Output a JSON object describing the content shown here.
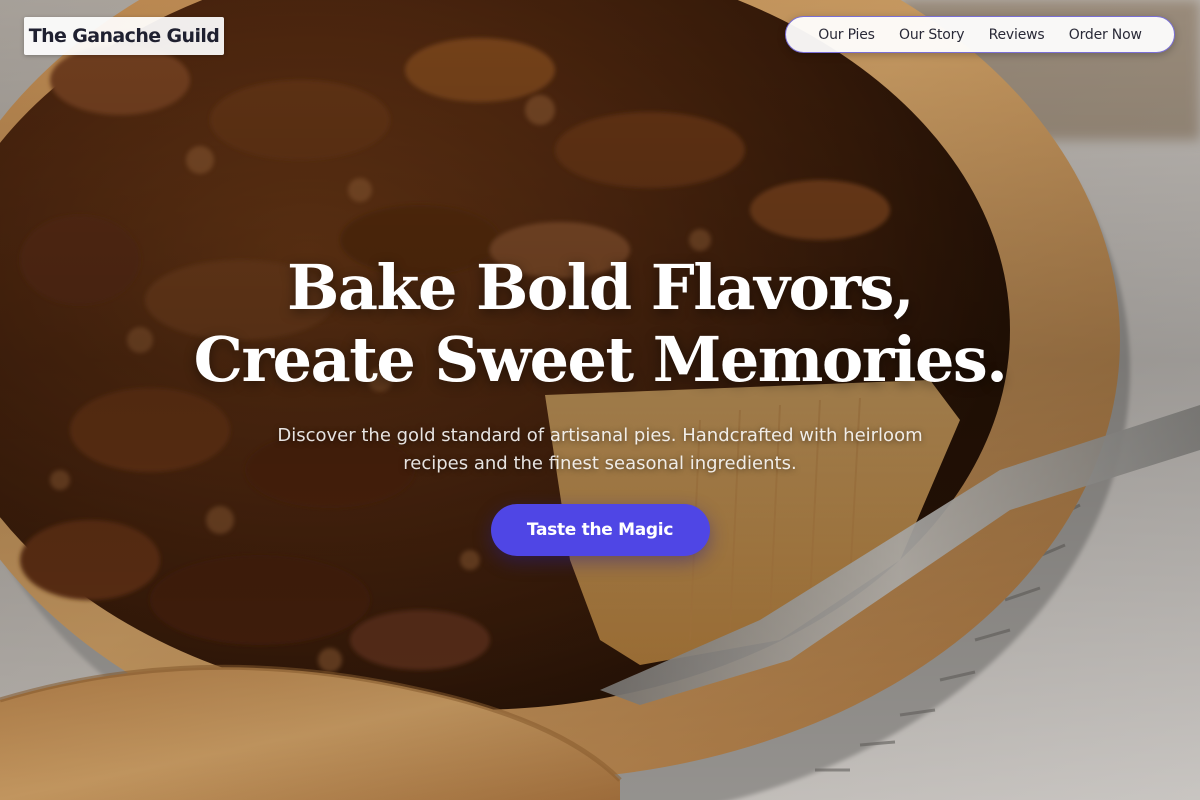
{
  "brand": {
    "name": "The Ganache Guild"
  },
  "nav": {
    "items": [
      {
        "label": "Our Pies"
      },
      {
        "label": "Our Story"
      },
      {
        "label": "Reviews"
      },
      {
        "label": "Order Now"
      }
    ]
  },
  "hero": {
    "headline_line1": "Bake Bold Flavors,",
    "headline_line2": "Create Sweet Memories.",
    "subtext": "Discover the gold standard of artisanal pies. Handcrafted with heirloom recipes and the finest seasonal ingredients.",
    "cta_label": "Taste the Magic",
    "background_image": "pecan-pie-photo"
  },
  "colors": {
    "accent": "#4f46e5",
    "nav_border": "#7a6fd6",
    "brand_text": "#1f2030"
  }
}
